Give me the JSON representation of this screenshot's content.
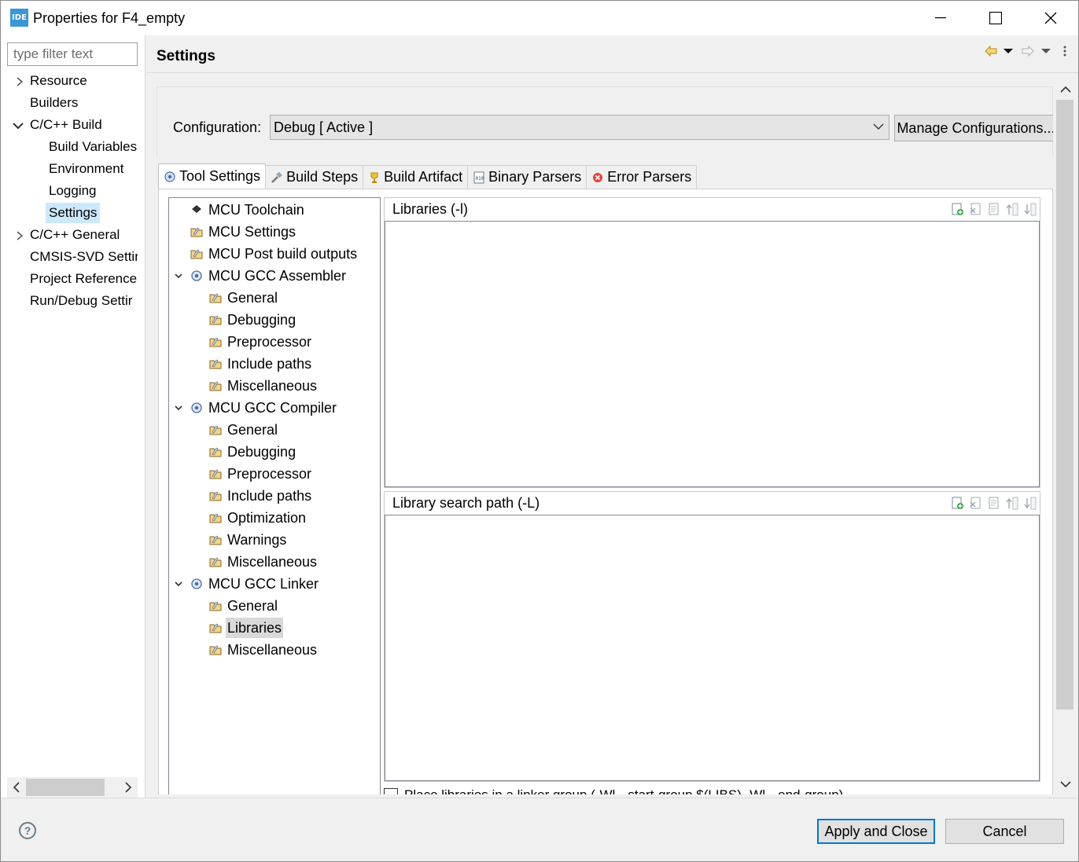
{
  "window": {
    "title": "Properties for F4_empty",
    "app_icon_text": "IDE"
  },
  "nav": {
    "filter_placeholder": "type filter text",
    "items": [
      {
        "label": "Resource"
      },
      {
        "label": "Builders"
      },
      {
        "label": "C/C++ Build"
      },
      {
        "label": "Build Variables"
      },
      {
        "label": "Environment"
      },
      {
        "label": "Logging"
      },
      {
        "label": "Settings"
      },
      {
        "label": "C/C++ General"
      },
      {
        "label": "CMSIS-SVD Settir"
      },
      {
        "label": "Project References"
      },
      {
        "label": "Run/Debug Settir"
      }
    ]
  },
  "page": {
    "title": "Settings"
  },
  "config": {
    "label": "Configuration:",
    "value": "Debug  [ Active ]",
    "manage_label": "Manage Configurations..."
  },
  "tabs": [
    {
      "label": "Tool Settings"
    },
    {
      "label": "Build Steps"
    },
    {
      "label": "Build Artifact"
    },
    {
      "label": "Binary Parsers"
    },
    {
      "label": "Error Parsers"
    }
  ],
  "tool_tree": [
    {
      "label": "MCU Toolchain"
    },
    {
      "label": "MCU Settings"
    },
    {
      "label": "MCU Post build outputs"
    },
    {
      "label": "MCU GCC Assembler"
    },
    {
      "label": "General"
    },
    {
      "label": "Debugging"
    },
    {
      "label": "Preprocessor"
    },
    {
      "label": "Include paths"
    },
    {
      "label": "Miscellaneous"
    },
    {
      "label": "MCU GCC Compiler"
    },
    {
      "label": "General"
    },
    {
      "label": "Debugging"
    },
    {
      "label": "Preprocessor"
    },
    {
      "label": "Include paths"
    },
    {
      "label": "Optimization"
    },
    {
      "label": "Warnings"
    },
    {
      "label": "Miscellaneous"
    },
    {
      "label": "MCU GCC Linker"
    },
    {
      "label": "General"
    },
    {
      "label": "Libraries"
    },
    {
      "label": "Miscellaneous"
    }
  ],
  "panels": {
    "libraries_title": "Libraries (-l)",
    "search_path_title": "Library search path (-L)",
    "group_checkbox_label": "Place libraries in a linker group (-Wl,--start-group $(LIBS) -Wl,--end-group)"
  },
  "buttons": {
    "help": "?",
    "apply_close": "Apply and Close",
    "cancel": "Cancel"
  }
}
